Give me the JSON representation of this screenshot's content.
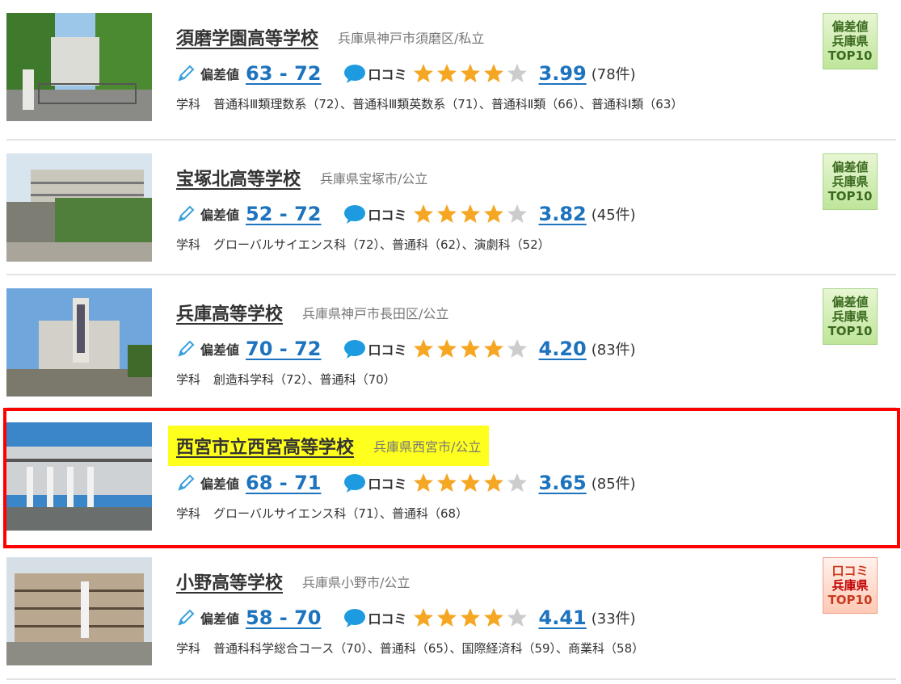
{
  "labels": {
    "hensachi": "偏差値",
    "kuchikomi": "口コミ",
    "dept_prefix": "学科"
  },
  "colors": {
    "link_blue": "#1e73be",
    "star_gold": "#f5a623",
    "star_empty": "#cccccc",
    "highlight_yellow": "#ffff1e",
    "frame_red": "#ff0000",
    "badge_green": "#bfe59a",
    "badge_red": "#ffc9b6"
  },
  "schools": [
    {
      "name": "須磨学園高等学校",
      "location": "兵庫県神戸市須磨区/私立",
      "hensachi_range": "63 - 72",
      "rating_value": "3.99",
      "review_count": "(78件)",
      "stars_filled": 4,
      "departments": "普通科Ⅲ類理数系（72）、普通科Ⅲ類英数系（71）、普通科Ⅱ類（66）、普通科Ⅰ類（63）",
      "badge": {
        "line1": "偏差値",
        "line2": "兵庫県",
        "line3": "TOP10",
        "style": "green"
      }
    },
    {
      "name": "宝塚北高等学校",
      "location": "兵庫県宝塚市/公立",
      "hensachi_range": "52 - 72",
      "rating_value": "3.82",
      "review_count": "(45件)",
      "stars_filled": 4,
      "departments": "グローバルサイエンス科（72）、普通科（62）、演劇科（52）",
      "badge": {
        "line1": "偏差値",
        "line2": "兵庫県",
        "line3": "TOP10",
        "style": "green"
      }
    },
    {
      "name": "兵庫高等学校",
      "location": "兵庫県神戸市長田区/公立",
      "hensachi_range": "70 - 72",
      "rating_value": "4.20",
      "review_count": "(83件)",
      "stars_filled": 4,
      "departments": "創造科学科（72）、普通科（70）",
      "badge": {
        "line1": "偏差値",
        "line2": "兵庫県",
        "line3": "TOP10",
        "style": "green"
      }
    },
    {
      "name": "西宮市立西宮高等学校",
      "location": "兵庫県西宮市/公立",
      "hensachi_range": "68 - 71",
      "rating_value": "3.65",
      "review_count": "(85件)",
      "stars_filled": 4,
      "departments": "グローバルサイエンス科（71）、普通科（68）",
      "highlighted": true
    },
    {
      "name": "小野高等学校",
      "location": "兵庫県小野市/公立",
      "hensachi_range": "58 - 70",
      "rating_value": "4.41",
      "review_count": "(33件)",
      "stars_filled": 4,
      "departments": "普通科科学総合コース（70）、普通科（65）、国際経済科（59）、商業科（58）",
      "badge": {
        "line1": "口コミ",
        "line2": "兵庫県",
        "line3": "TOP10",
        "style": "red"
      }
    }
  ]
}
